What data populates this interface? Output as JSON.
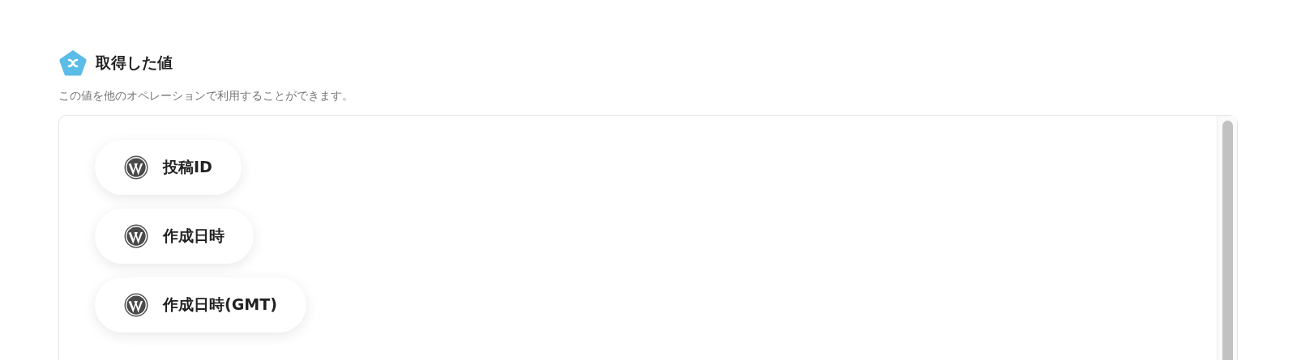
{
  "section": {
    "title": "取得した値",
    "description": "この値を他のオペレーションで利用することができます。"
  },
  "values": [
    {
      "label": "投稿ID"
    },
    {
      "label": "作成日時"
    },
    {
      "label": "作成日時(GMT)"
    }
  ]
}
